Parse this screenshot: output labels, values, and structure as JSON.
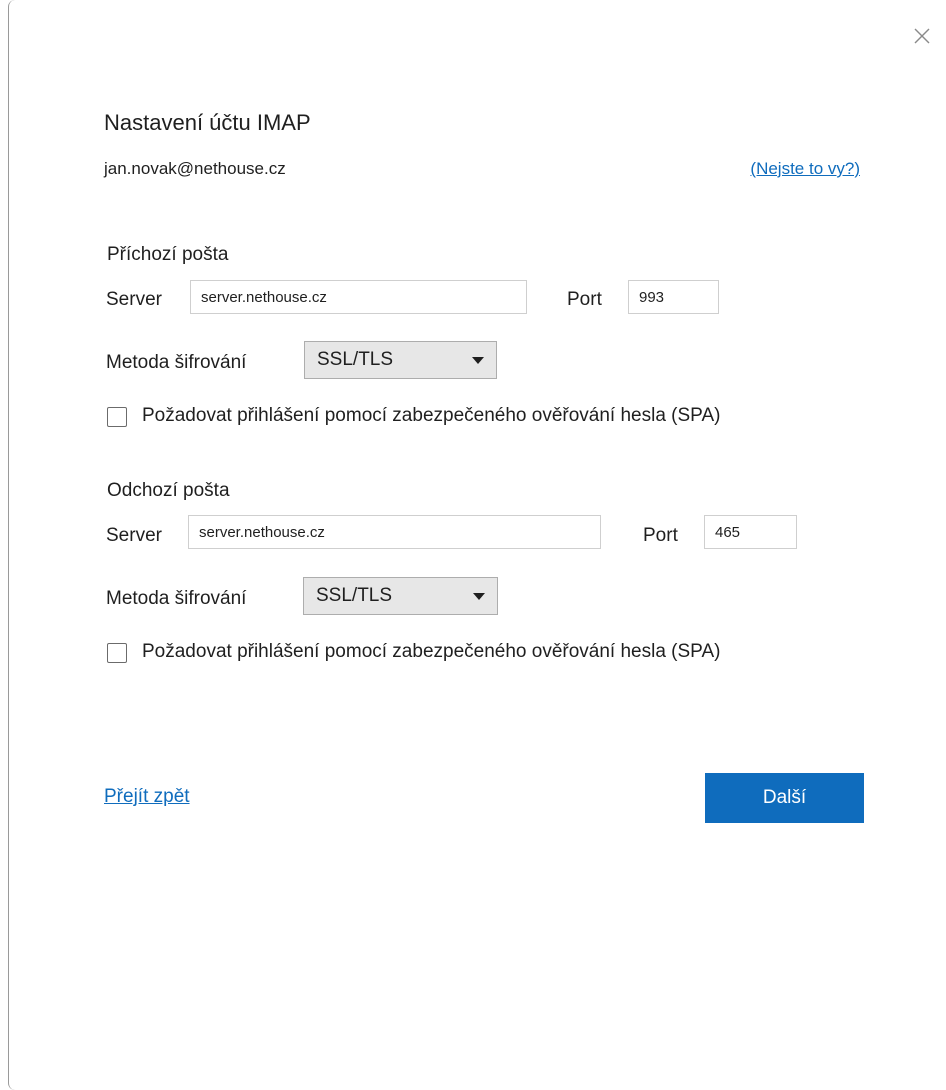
{
  "dialog": {
    "title": "Nastavení účtu IMAP",
    "email": "jan.novak@nethouse.cz",
    "not_you_link": "(Nejste to vy?)",
    "close_icon": "close-icon"
  },
  "incoming": {
    "section_label": "Příchozí pošta",
    "server_label": "Server",
    "server_value": "server.nethouse.cz",
    "port_label": "Port",
    "port_value": "993",
    "encryption_label": "Metoda šifrování",
    "encryption_value": "SSL/TLS",
    "spa_label": "Požadovat přihlášení pomocí zabezpečeného ověřování hesla (SPA)",
    "spa_checked": false
  },
  "outgoing": {
    "section_label": "Odchozí pošta",
    "server_label": "Server",
    "server_value": "server.nethouse.cz",
    "port_label": "Port",
    "port_value": "465",
    "encryption_label": "Metoda šifrování",
    "encryption_value": "SSL/TLS",
    "spa_label": "Požadovat přihlášení pomocí zabezpečeného ověřování hesla (SPA)",
    "spa_checked": false
  },
  "footer": {
    "back_link": "Přejít zpět",
    "next_button": "Další"
  },
  "colors": {
    "accent": "#0f6cbd",
    "select_bg": "#e7e7e7"
  }
}
